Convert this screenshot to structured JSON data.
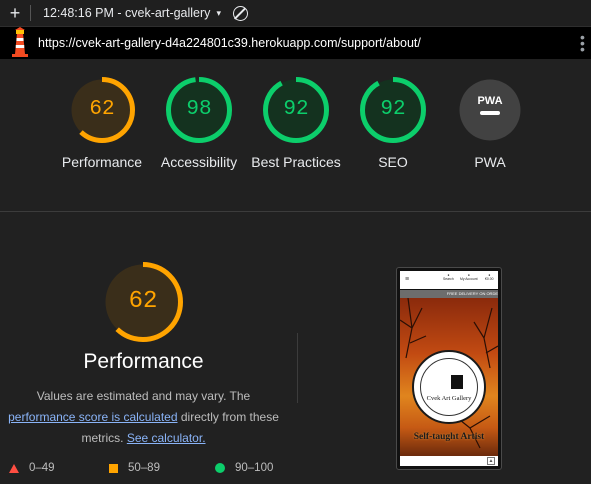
{
  "toolbar": {
    "add_label": "+",
    "report_label": "12:48:16 PM - cvek-art-gallery",
    "caret": "▾",
    "clear_icon": "clear-icon"
  },
  "urlbar": {
    "url": "https://cvek-art-gallery-d4a224801c39.herokuapp.com/support/about/",
    "menu": "⋮",
    "icon": "lighthouse-icon"
  },
  "gauges": [
    {
      "label": "Performance",
      "score": "62",
      "fraction": 0.62,
      "color": "#ffa400",
      "bg": "#3a2e1a"
    },
    {
      "label": "Accessibility",
      "score": "98",
      "fraction": 0.98,
      "color": "#0cce6b",
      "bg": "#14321f"
    },
    {
      "label": "Best Practices",
      "score": "92",
      "fraction": 0.92,
      "color": "#0cce6b",
      "bg": "#14321f"
    },
    {
      "label": "SEO",
      "score": "92",
      "fraction": 0.92,
      "color": "#0cce6b",
      "bg": "#14321f"
    },
    {
      "label": "PWA",
      "score": "PWA",
      "fraction": 0,
      "color": "#ffffff",
      "bg": "#424242"
    }
  ],
  "performance": {
    "score": "62",
    "fraction": 0.62,
    "title": "Performance",
    "desc_line1": "Values are estimated and may vary. The",
    "link_calc": "performance score is calculated",
    "desc_line2b": "directly from these",
    "desc_line3a": "metrics.",
    "link_calculator": "See calculator."
  },
  "legend": [
    {
      "range": "0–49",
      "color": "#ff4e42"
    },
    {
      "range": "50–89",
      "color": "#ffa400"
    },
    {
      "range": "90–100",
      "color": "#0cce6b"
    }
  ],
  "screenshot": {
    "nav_search": "Search",
    "nav_account": "My Account",
    "nav_bag": "€0.00",
    "banner": "FREE DELIVERY ON ORDE",
    "brand": "Cvek Art Gallery",
    "tagline": "Self-taught Artist",
    "menu_icon": "hamburger-icon",
    "up_icon": "back-to-top-icon",
    "up_glyph": "▲"
  }
}
